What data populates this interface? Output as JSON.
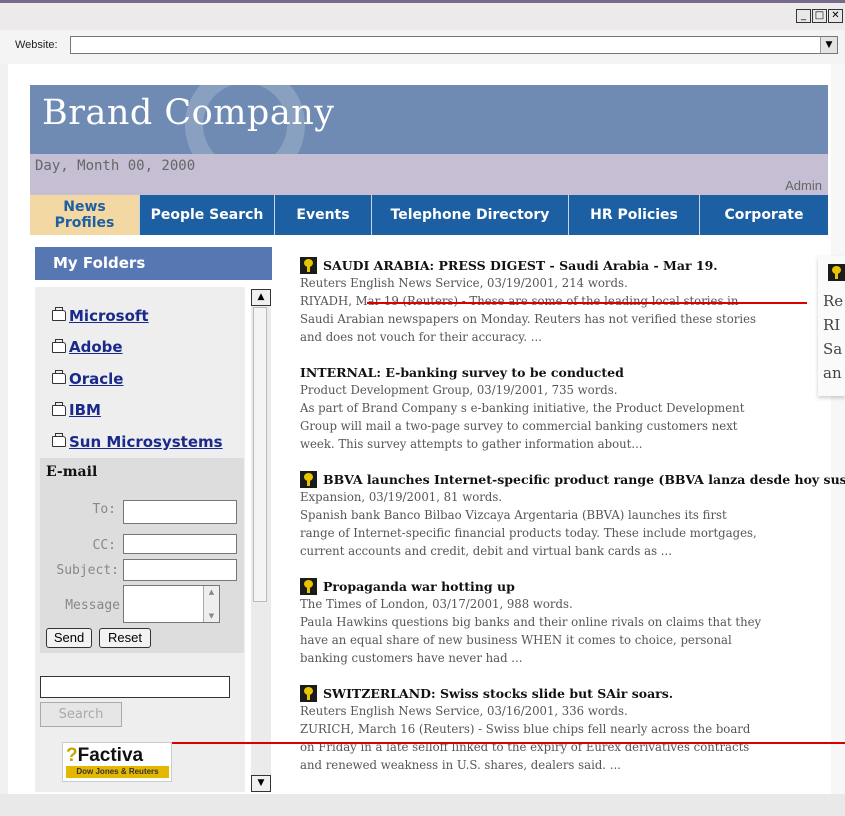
{
  "window": {
    "minimize": "_",
    "maximize": "□",
    "close": "✕"
  },
  "address_bar": {
    "label": "Website:",
    "value": "",
    "dropdown_icon": "chevron-down-icon"
  },
  "banner": {
    "title": "Brand Company",
    "date": "Day, Month 00, 2000",
    "user": "Admin"
  },
  "nav": {
    "items": [
      {
        "line1": "News",
        "line2": "Profiles",
        "active": true
      },
      {
        "line1": "People Search",
        "line2": ""
      },
      {
        "line1": "Events",
        "line2": ""
      },
      {
        "line1": "Telephone Directory",
        "line2": ""
      },
      {
        "line1": "HR Policies",
        "line2": ""
      },
      {
        "line1": "Corporate",
        "line2": ""
      }
    ]
  },
  "sidebar": {
    "folders_title": "My Folders",
    "folders": [
      "Microsoft",
      "Adobe",
      "Oracle",
      "IBM",
      "Sun Microsystems"
    ],
    "email": {
      "title": "E-mail",
      "to_label": "To:",
      "cc_label": "CC:",
      "subject_label": "Subject:",
      "message_label": "Message",
      "send_label": "Send",
      "reset_label": "Reset"
    },
    "search": {
      "value": "",
      "button_label": "Search"
    },
    "logo": {
      "word": "Factiva",
      "tagline": "Dow Jones & Reuters"
    }
  },
  "articles": [
    {
      "headline": "SAUDI ARABIA: PRESS DIGEST - Saudi Arabia - Mar 19.",
      "has_icon": true,
      "source": "Reuters English News Service, 03/19/2001, 214 words.",
      "lines": [
        "RIYADH, Mar 19 (Reuters) - These are some of the leading local stories in",
        "Saudi Arabian newspapers on Monday. Reuters has not verified these stories",
        "and does not vouch for their accuracy. ..."
      ]
    },
    {
      "headline": "INTERNAL: E-banking survey to be conducted",
      "has_icon": false,
      "source": "Product Development Group, 03/19/2001, 735 words.",
      "lines": [
        "As part of Brand Company s e-banking initiative, the Product Development",
        "Group will mail a two-page survey to commercial banking customers next",
        "week. This survey attempts to gather information about..."
      ]
    },
    {
      "headline": "BBVA launches Internet-specific product range (BBVA lanza desde hoy sus ...",
      "has_icon": true,
      "source": "Expansion, 03/19/2001, 81 words.",
      "lines": [
        "Spanish bank Banco Bilbao Vizcaya Argentaria (BBVA) launches its first",
        "range of Internet-specific financial products today. These include mortgages,",
        "current accounts and credit, debit and virtual bank cards as ..."
      ]
    },
    {
      "headline": "Propaganda war hotting up",
      "has_icon": true,
      "source": "The Times of London, 03/17/2001, 988 words.",
      "lines": [
        "Paula Hawkins questions big banks and their online rivals on claims that they",
        "have an equal share of new business WHEN it comes to choice, personal",
        "banking customers have never had ..."
      ]
    },
    {
      "headline": "SWITZERLAND: Swiss stocks slide but SAir soars.",
      "has_icon": true,
      "source": "Reuters English News Service, 03/16/2001, 336 words.",
      "lines": [
        "ZURICH, March 16 (Reuters) - Swiss blue chips fell nearly across the board",
        "on Friday in a late selloff linked to the expiry of Eurex derivatives contracts",
        "and renewed weakness in U.S. shares, dealers said. ..."
      ]
    }
  ],
  "callout": {
    "lines": [
      "Re",
      "RI",
      "Sa",
      "an"
    ]
  },
  "colors": {
    "banner": "#6f8bb4",
    "nav": "#1d5fa3",
    "nav_active": "#f4d8a4",
    "date_band": "#c6bfd4",
    "folders_head": "#5777b2",
    "annotation_line": "#d80000"
  }
}
